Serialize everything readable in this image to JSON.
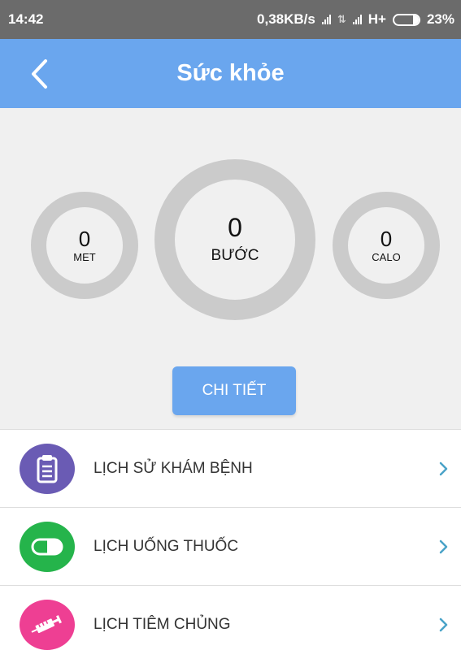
{
  "statusbar": {
    "time": "14:42",
    "speed": "0,38KB/s",
    "network": "H+",
    "battery": "23%",
    "battery_level": 0.23
  },
  "appbar": {
    "title": "Sức khỏe",
    "back_icon": "chevron-left-icon"
  },
  "stats": {
    "meters": {
      "value": "0",
      "unit": "MET"
    },
    "steps": {
      "value": "0",
      "unit": "BƯỚC"
    },
    "calories": {
      "value": "0",
      "unit": "CALO"
    }
  },
  "detail_button": "CHI TIẾT",
  "menu": [
    {
      "label": "LỊCH SỬ KHÁM BỆNH",
      "icon": "clipboard-icon",
      "color": "#6a5bb4"
    },
    {
      "label": "LỊCH UỐNG THUỐC",
      "icon": "pill-icon",
      "color": "#25b44b"
    },
    {
      "label": "LỊCH TIÊM CHỦNG",
      "icon": "syringe-icon",
      "color": "#ee3f93"
    }
  ],
  "colors": {
    "primary": "#6aa6ee",
    "ring": "#cbcbcb",
    "chevron": "#4aa3c8"
  }
}
